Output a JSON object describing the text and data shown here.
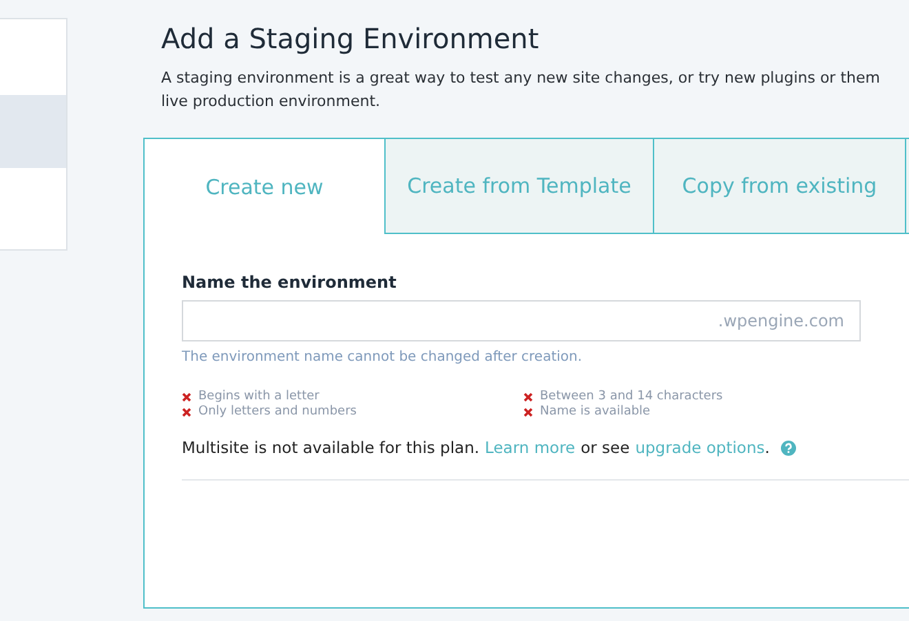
{
  "sidebar": {
    "items": [
      {
        "selected": false
      },
      {
        "selected": true
      },
      {
        "selected": false
      }
    ]
  },
  "page": {
    "title": "Add a Staging Environment",
    "description": [
      "A staging environment is a great way to test any new site changes, or try new plugins or them",
      "live production environment."
    ]
  },
  "tabs": [
    {
      "label": "Create new",
      "selected": true
    },
    {
      "label": "Create from Template",
      "selected": false
    },
    {
      "label": "Copy from existing",
      "selected": false
    },
    {
      "selected": false
    }
  ],
  "form": {
    "label": "Name the environment",
    "suffix": ".wpengine.com",
    "hint": "The environment name cannot be changed after creation.",
    "rules": [
      {
        "text": "Begins with a letter",
        "met": false
      },
      {
        "text": "Between 3 and 14 characters",
        "met": false
      },
      {
        "text": "Only letters and numbers",
        "met": false
      },
      {
        "text": "Name is available",
        "met": false
      }
    ]
  },
  "multisite": {
    "text": "Multisite is not available for this plan.",
    "link1": "Learn more",
    "middle": "or see",
    "link2": "upgrade options",
    "end": "."
  }
}
